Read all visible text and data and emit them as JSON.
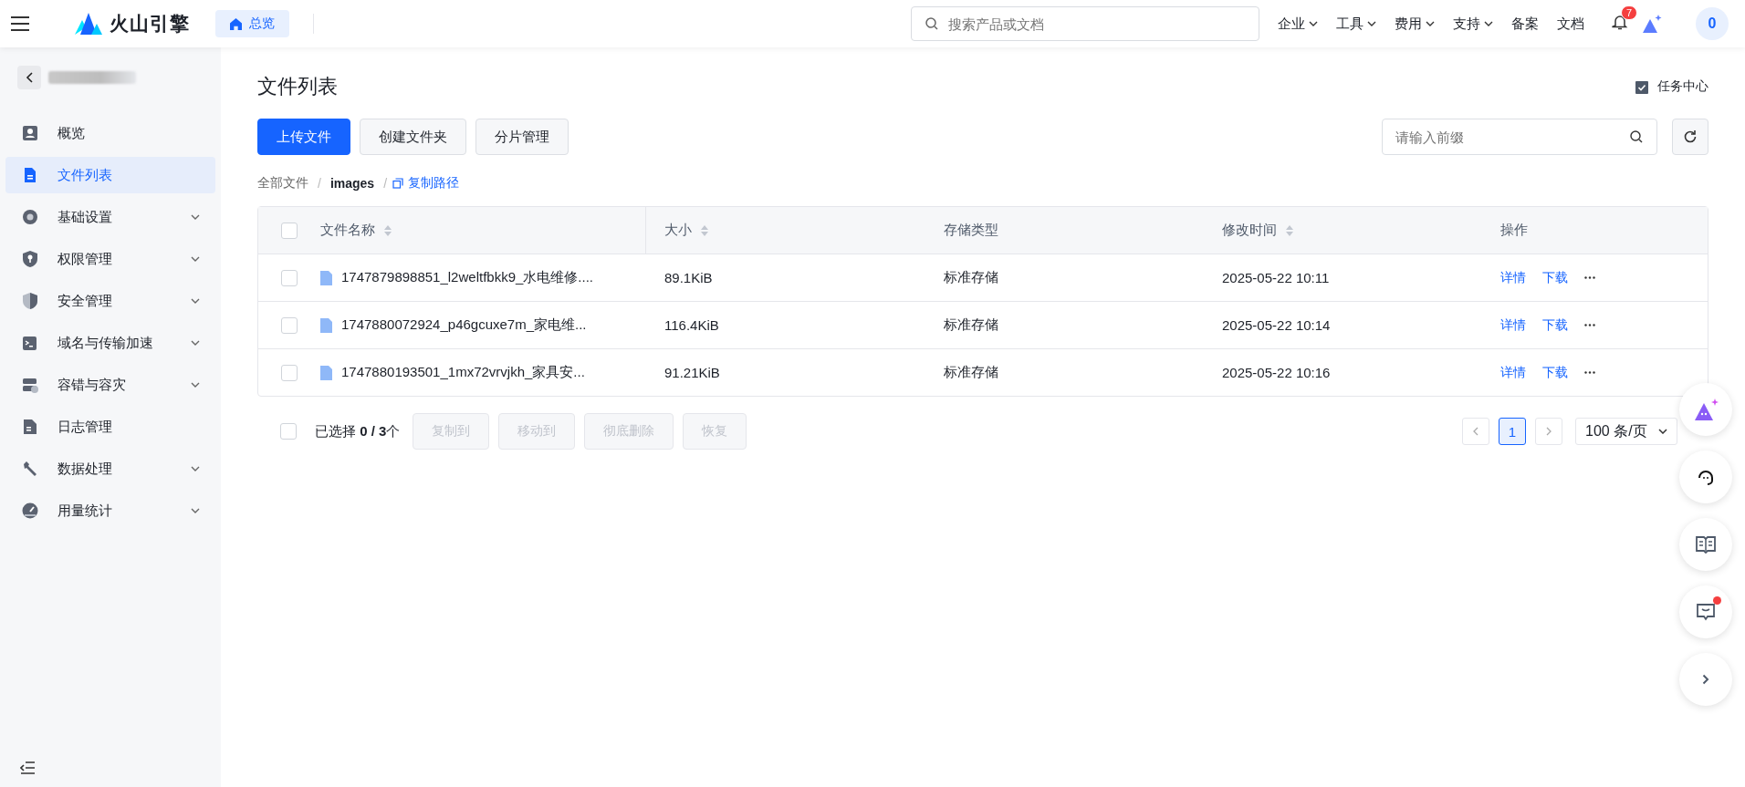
{
  "header": {
    "logo": "火山引擎",
    "home_tab": "总览",
    "search": {
      "placeholder": "搜索产品或文档"
    },
    "nav": [
      {
        "label": "企业",
        "dropdown": true
      },
      {
        "label": "工具",
        "dropdown": true
      },
      {
        "label": "费用",
        "dropdown": true
      },
      {
        "label": "支持",
        "dropdown": true
      },
      {
        "label": "备案",
        "dropdown": false
      },
      {
        "label": "文档",
        "dropdown": false
      }
    ],
    "notification_count": "7",
    "avatar": "0"
  },
  "sidebar": {
    "items": [
      {
        "label": "概览",
        "expandable": false,
        "selected": false
      },
      {
        "label": "文件列表",
        "expandable": false,
        "selected": true
      },
      {
        "label": "基础设置",
        "expandable": true,
        "selected": false
      },
      {
        "label": "权限管理",
        "expandable": true,
        "selected": false
      },
      {
        "label": "安全管理",
        "expandable": true,
        "selected": false
      },
      {
        "label": "域名与传输加速",
        "expandable": true,
        "selected": false
      },
      {
        "label": "容错与容灾",
        "expandable": true,
        "selected": false
      },
      {
        "label": "日志管理",
        "expandable": false,
        "selected": false
      },
      {
        "label": "数据处理",
        "expandable": true,
        "selected": false
      },
      {
        "label": "用量统计",
        "expandable": true,
        "selected": false
      }
    ]
  },
  "page": {
    "title": "文件列表",
    "task_center": "任务中心",
    "buttons": [
      {
        "label": "上传文件",
        "primary": true
      },
      {
        "label": "创建文件夹",
        "primary": false
      },
      {
        "label": "分片管理",
        "primary": false
      }
    ],
    "prefix_search": {
      "placeholder": "请输入前缀"
    },
    "breadcrumb": [
      {
        "kind": "item",
        "text": "全部文件"
      },
      {
        "kind": "separator",
        "text": "/"
      },
      {
        "kind": "current",
        "text": "images"
      },
      {
        "kind": "separator",
        "text": "/"
      }
    ],
    "copy_path": "复制路径"
  },
  "table": {
    "select_all": false,
    "columns": [
      {
        "label": "文件名称",
        "sortable": true
      },
      {
        "label": "大小",
        "sortable": true
      },
      {
        "label": "存储类型",
        "sortable": false
      },
      {
        "label": "修改时间",
        "sortable": true
      },
      {
        "label": "操作",
        "sortable": false
      }
    ],
    "rows": [
      {
        "checked": false,
        "name": "1747879898851_l2weltfbkk9_水电维修....",
        "size": "89.1KiB",
        "storage": "标准存储",
        "modified": "2025-05-22 10:11",
        "actions": [
          "详情",
          "下载"
        ]
      },
      {
        "checked": false,
        "name": "1747880072924_p46gcuxe7m_家电维...",
        "size": "116.4KiB",
        "storage": "标准存储",
        "modified": "2025-05-22 10:14",
        "actions": [
          "详情",
          "下载"
        ]
      },
      {
        "checked": false,
        "name": "1747880193501_1mx72vrvjkh_家具安...",
        "size": "91.21KiB",
        "storage": "标准存储",
        "modified": "2025-05-22 10:16",
        "actions": [
          "详情",
          "下载"
        ]
      }
    ]
  },
  "footer": {
    "select_all": false,
    "selection": "已选择 **0 / 3**个",
    "bulk_buttons": [
      {
        "label": "复制到",
        "disabled": true
      },
      {
        "label": "移动到",
        "disabled": true
      },
      {
        "label": "彻底删除",
        "disabled": true
      },
      {
        "label": "恢复",
        "disabled": true
      }
    ],
    "pages": [
      {
        "label": "1",
        "selected": true
      }
    ],
    "page_size": "100 条/页"
  }
}
